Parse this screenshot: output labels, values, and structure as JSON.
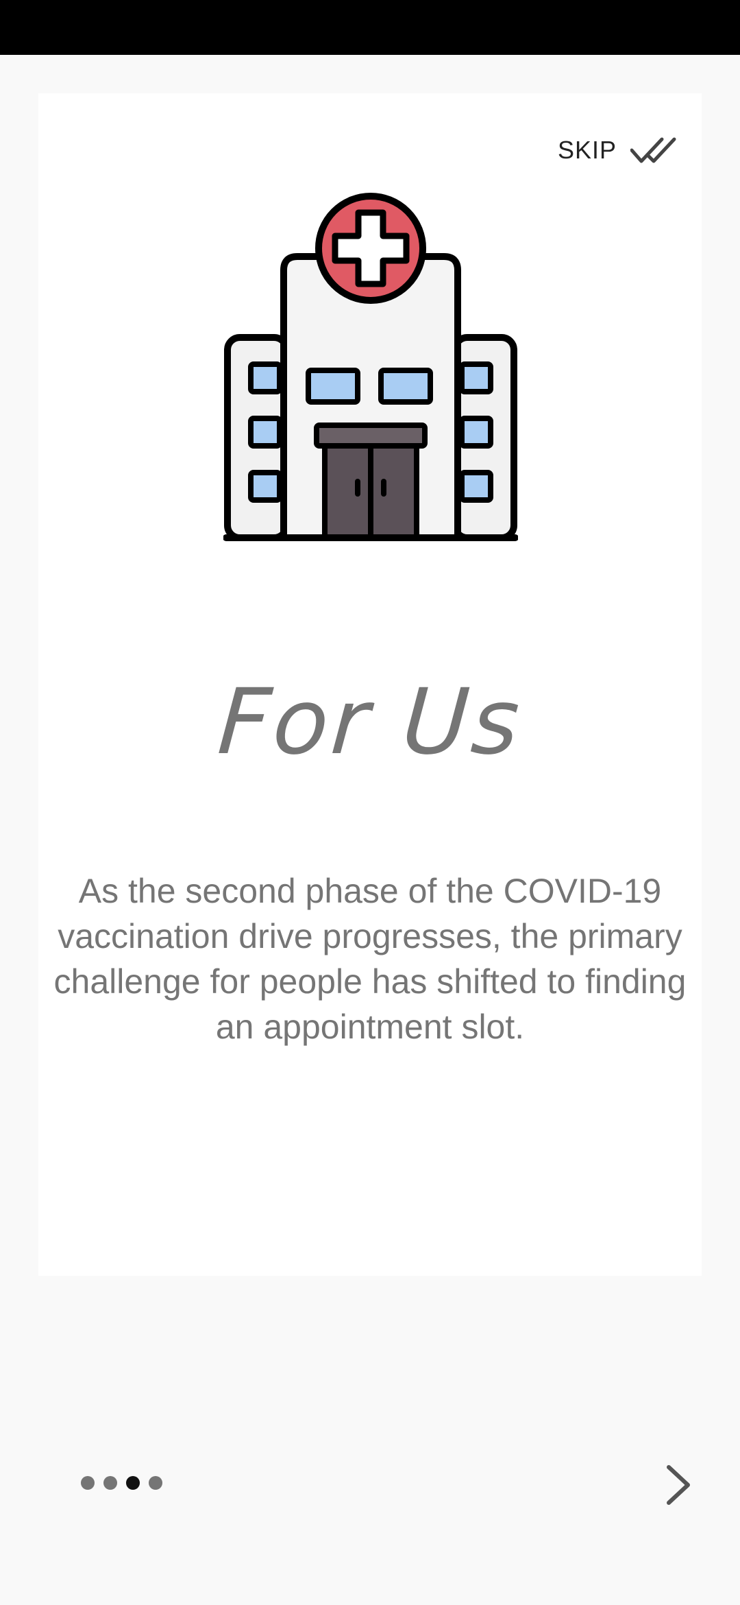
{
  "onboarding": {
    "skip_label": "SKIP",
    "title": "For Us",
    "description": "As the second phase of the COVID-19 vaccination drive progresses, the primary challenge for people has shifted to finding an appointment slot.",
    "illustration": "hospital-building-icon",
    "pager": {
      "total": 4,
      "current_index": 2
    },
    "next_icon": "chevron-right-icon"
  },
  "colors": {
    "background": "#f9f9f9",
    "card": "#ffffff",
    "status_bar": "#000000",
    "text_gray": "#757575",
    "active_dot": "#111111",
    "hospital_red": "#e05a64",
    "window_blue": "#a9cdf3",
    "door_dark": "#5b5158"
  }
}
